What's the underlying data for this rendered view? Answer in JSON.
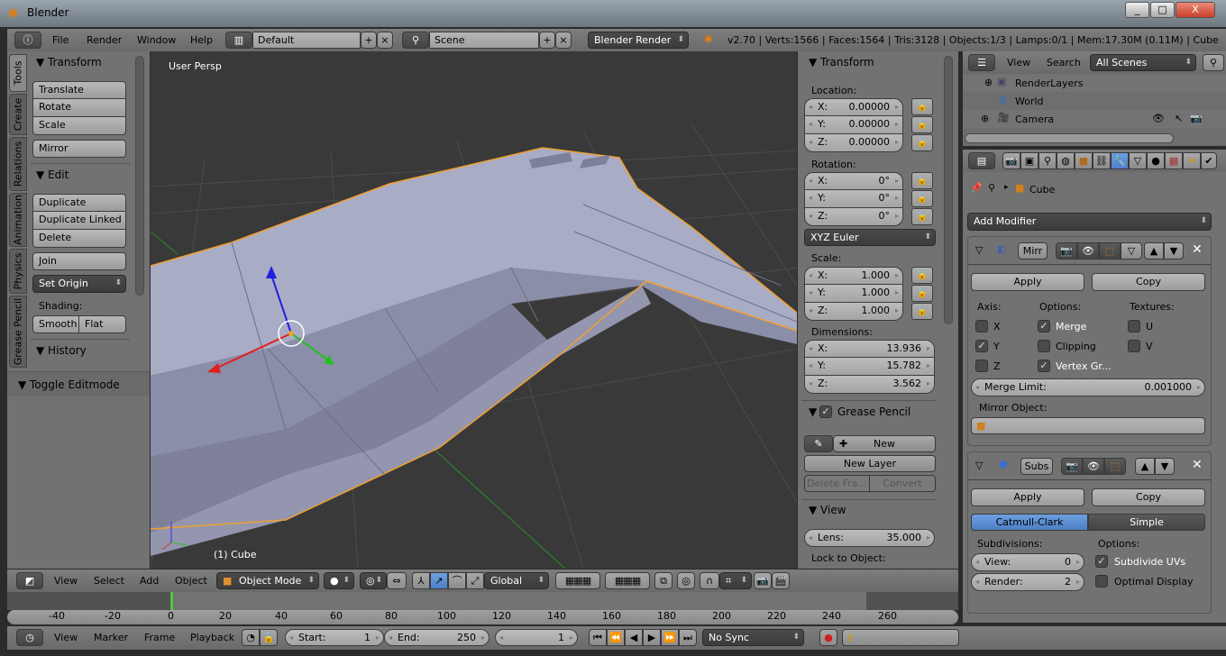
{
  "window": {
    "title": "Blender",
    "controls": [
      "_",
      "□",
      "X"
    ]
  },
  "info_header": {
    "menus": [
      "File",
      "Render",
      "Window",
      "Help"
    ],
    "screen_layout": "Default",
    "scene": "Scene",
    "render_engine": "Blender Render",
    "stats": "v2.70 | Verts:1566 | Faces:1564 | Tris:3128 | Objects:1/3 | Lamps:0/1 | Mem:17.30M (0.11M) | Cube"
  },
  "tool_tabs": [
    "Tools",
    "Create",
    "Relations",
    "Animation",
    "Physics",
    "Grease Pencil"
  ],
  "tools": {
    "transform": {
      "title": "Transform",
      "buttons": [
        "Translate",
        "Rotate",
        "Scale"
      ],
      "mirror": "Mirror"
    },
    "edit": {
      "title": "Edit",
      "buttons": [
        "Duplicate",
        "Duplicate Linked",
        "Delete"
      ],
      "join": "Join",
      "set_origin": "Set Origin",
      "shading_label": "Shading:",
      "smooth": "Smooth",
      "flat": "Flat"
    },
    "history": {
      "title": "History"
    },
    "operator": {
      "title": "Toggle Editmode"
    }
  },
  "viewport": {
    "view_name": "User Persp",
    "object_label": "(1) Cube"
  },
  "npanel": {
    "transform_title": "Transform",
    "location": {
      "label": "Location:",
      "x": "0.00000",
      "y": "0.00000",
      "z": "0.00000"
    },
    "rotation": {
      "label": "Rotation:",
      "x": "0°",
      "y": "0°",
      "z": "0°",
      "mode": "XYZ Euler"
    },
    "scale": {
      "label": "Scale:",
      "x": "1.000",
      "y": "1.000",
      "z": "1.000"
    },
    "dimensions": {
      "label": "Dimensions:",
      "x": "13.936",
      "y": "15.782",
      "z": "3.562"
    },
    "axis": {
      "x": "X:",
      "y": "Y:",
      "z": "Z:"
    },
    "grease_pencil": {
      "title": "Grease Pencil",
      "enabled": true,
      "new": "New",
      "new_layer": "New Layer",
      "delete_frame": "Delete Fra...",
      "convert": "Convert"
    },
    "view": {
      "title": "View",
      "lens_label": "Lens:",
      "lens": "35.000",
      "lock_label": "Lock to Object:"
    }
  },
  "outliner": {
    "menus": [
      "View",
      "Search"
    ],
    "filter": "All Scenes",
    "items": [
      "RenderLayers",
      "World",
      "Camera"
    ]
  },
  "properties": {
    "breadcrumb": "Cube",
    "add_modifier": "Add Modifier",
    "mirror": {
      "name": "Mirr",
      "apply": "Apply",
      "copy": "Copy",
      "axis_label": "Axis:",
      "options_label": "Options:",
      "textures_label": "Textures:",
      "axis": [
        {
          "label": "X",
          "checked": false
        },
        {
          "label": "Y",
          "checked": true
        },
        {
          "label": "Z",
          "checked": false
        }
      ],
      "options": [
        {
          "label": "Merge",
          "checked": true
        },
        {
          "label": "Clipping",
          "checked": false
        },
        {
          "label": "Vertex Gr...",
          "checked": true
        }
      ],
      "textures": [
        {
          "label": "U",
          "checked": false
        },
        {
          "label": "V",
          "checked": false
        }
      ],
      "merge_limit_label": "Merge Limit:",
      "merge_limit": "0.001000",
      "mirror_object_label": "Mirror Object:"
    },
    "subsurf": {
      "name": "Subs",
      "apply": "Apply",
      "copy": "Copy",
      "catmull": "Catmull-Clark",
      "simple": "Simple",
      "subdivisions_label": "Subdivisions:",
      "options_label": "Options:",
      "view_label": "View:",
      "view": "0",
      "render_label": "Render:",
      "render": "2",
      "subdivide_uvs": {
        "label": "Subdivide UVs",
        "checked": true
      },
      "optimal_display": {
        "label": "Optimal Display",
        "checked": false
      }
    }
  },
  "view3d_header": {
    "menus": [
      "View",
      "Select",
      "Add",
      "Object"
    ],
    "mode": "Object Mode",
    "orientation": "Global"
  },
  "timeline": {
    "ticks": [
      "-40",
      "-20",
      "0",
      "20",
      "40",
      "60",
      "80",
      "100",
      "120",
      "140",
      "160",
      "180",
      "200",
      "220",
      "240",
      "260"
    ],
    "current_frame_marker": 0,
    "menus": [
      "View",
      "Marker",
      "Frame",
      "Playback"
    ],
    "start_label": "Start:",
    "start": "1",
    "end_label": "End:",
    "end": "250",
    "current": "1",
    "sync": "No Sync"
  },
  "colors": {
    "accent": "#5680c2",
    "selection": "#f0a030",
    "viewport": "#393939",
    "panel": "#727272"
  }
}
